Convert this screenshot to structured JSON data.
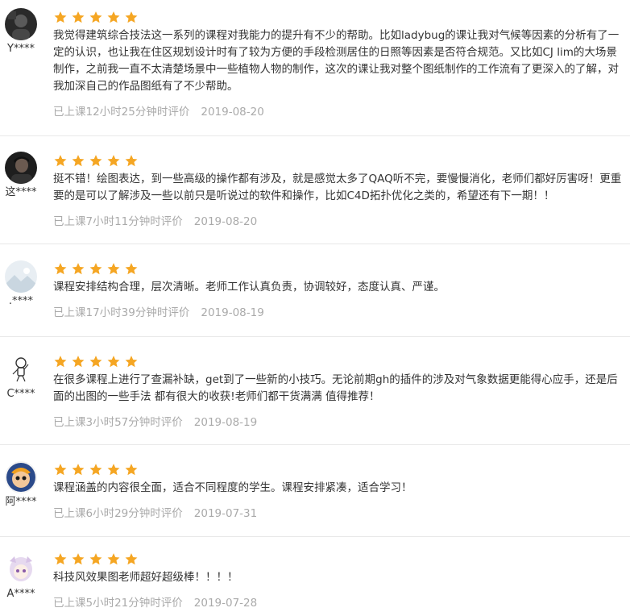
{
  "colors": {
    "star": "#f5a623",
    "text": "#333333",
    "meta": "#aaaaaa",
    "divider": "#e8e8e8"
  },
  "reviews": [
    {
      "username": "Y****",
      "rating": 5,
      "avatar_icon": "dark-portrait-avatar",
      "text": "我觉得建筑综合技法这一系列的课程对我能力的提升有不少的帮助。比如ladybug的课让我对气候等因素的分析有了一定的认识，也让我在住区规划设计时有了较为方便的手段检测居住的日照等因素是否符合规范。又比如CJ lim的大场景制作，之前我一直不太清楚场景中一些植物人物的制作，这次的课让我对整个图纸制作的工作流有了更深入的了解，对我加深自己的作品图纸有了不少帮助。",
      "study_time": "已上课12小时25分钟时评价",
      "date": "2019-08-20"
    },
    {
      "username": "这****",
      "rating": 5,
      "avatar_icon": "dark-person-avatar",
      "text": "挺不错！绘图表达，到一些高级的操作都有涉及，就是感觉太多了QAQ听不完，要慢慢消化，老师们都好厉害呀！更重要的是可以了解涉及一些以前只是听说过的软件和操作，比如C4D拓扑优化之类的，希望还有下一期！！",
      "study_time": "已上课7小时11分钟时评价",
      "date": "2019-08-20"
    },
    {
      "username": ".****",
      "rating": 5,
      "avatar_icon": "light-landscape-avatar",
      "text": "课程安排结构合理，层次清晰。老师工作认真负责，协调较好，态度认真、严谨。",
      "study_time": "已上课17小时39分钟时评价",
      "date": "2019-08-19"
    },
    {
      "username": "C****",
      "rating": 5,
      "avatar_icon": "astronaut-sketch-avatar",
      "text": "在很多课程上进行了查漏补缺，get到了一些新的小技巧。无论前期gh的插件的涉及对气象数据更能得心应手，还是后面的出图的一些手法 都有很大的收获!老师们都干货满满 值得推荐！",
      "study_time": "已上课3小时57分钟时评价",
      "date": "2019-08-19"
    },
    {
      "username": "阿****",
      "rating": 5,
      "avatar_icon": "cartoon-girl-avatar",
      "text": "课程涵盖的内容很全面，适合不同程度的学生。课程安排紧凑，适合学习！",
      "study_time": "已上课6小时29分钟时评价",
      "date": "2019-07-31"
    },
    {
      "username": "A****",
      "rating": 5,
      "avatar_icon": "anime-girl-avatar",
      "text": "科技风效果图老师超好超级棒！！！！",
      "study_time": "已上课5小时21分钟时评价",
      "date": "2019-07-28"
    }
  ]
}
